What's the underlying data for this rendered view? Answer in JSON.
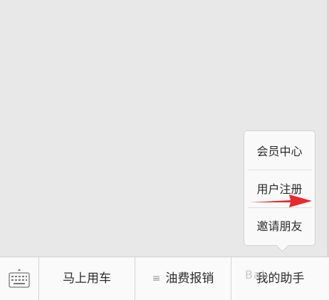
{
  "popup_menu": {
    "items": [
      {
        "label": "会员中心"
      },
      {
        "label": "用户注册"
      },
      {
        "label": "邀请朋友"
      }
    ]
  },
  "bottom_bar": {
    "keyboard_icon": "keyboard-icon",
    "tabs": [
      {
        "label": "马上用车"
      },
      {
        "label": "油费报销",
        "icon": "menu-lines-icon",
        "glyph": "≡"
      },
      {
        "label": "我的助手"
      }
    ]
  },
  "annotation": {
    "arrow_color": "#e8282a"
  },
  "watermark": {
    "text": "Bai"
  }
}
